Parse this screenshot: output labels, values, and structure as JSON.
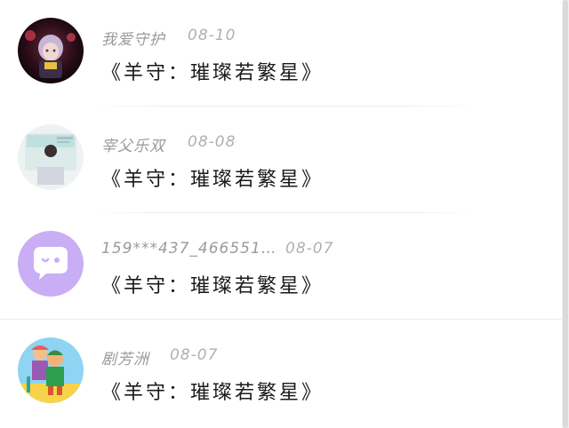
{
  "comments": [
    {
      "username": "我爱守护",
      "date": "08-10",
      "text": "《羊守：璀璨若繁星》",
      "avatar_icon": "anime-character-avatar"
    },
    {
      "username": "宰父乐双",
      "date": "08-08",
      "text": "《羊守：璀璨若繁星》",
      "avatar_icon": "photo-person-avatar"
    },
    {
      "username": "159***437_466551…",
      "date": "08-07",
      "text": "《羊守：璀璨若繁星》",
      "avatar_icon": "default-chat-bubble-avatar"
    },
    {
      "username": "剧芳洲",
      "date": "08-07",
      "text": "《羊守：璀璨若繁星》",
      "avatar_icon": "cartoon-kids-avatar"
    }
  ],
  "colors": {
    "username": "#9a9a9a",
    "date": "#b0b0b0",
    "comment_text": "#1a1a1a",
    "default_avatar_bg": "#c9aef5"
  }
}
